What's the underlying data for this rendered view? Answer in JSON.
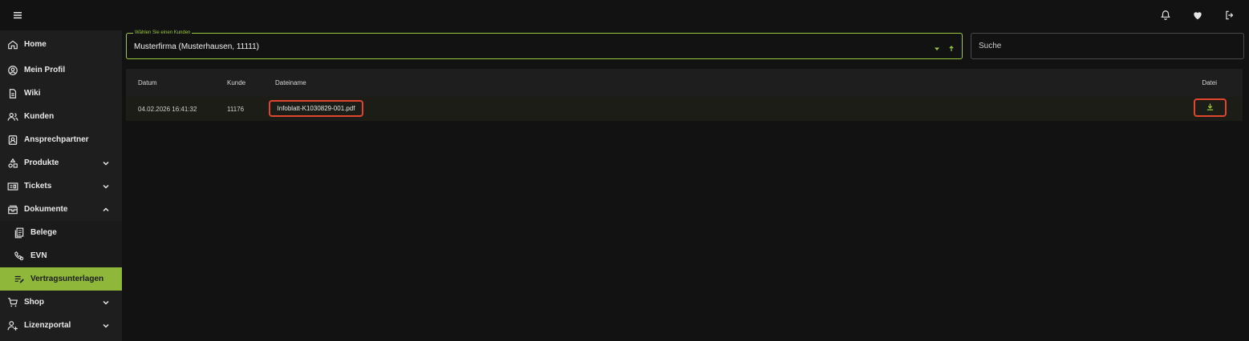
{
  "header": {
    "menu_icon": "hamburger-menu-icon",
    "icons": [
      "bell-icon",
      "heart-icon",
      "logout-icon"
    ]
  },
  "sidebar": {
    "items": [
      {
        "label": "Home",
        "icon": "home-icon"
      },
      {
        "label": "Mein Profil",
        "icon": "profile-icon"
      },
      {
        "label": "Wiki",
        "icon": "document-icon"
      },
      {
        "label": "Kunden",
        "icon": "users-icon"
      },
      {
        "label": "Ansprechpartner",
        "icon": "contact-card-icon"
      },
      {
        "label": "Produkte",
        "icon": "shapes-icon",
        "expandable": true
      },
      {
        "label": "Tickets",
        "icon": "ticket-icon",
        "expandable": true
      },
      {
        "label": "Dokumente",
        "icon": "folder-icon",
        "expandable": true,
        "expanded": true
      },
      {
        "label": "Belege",
        "icon": "receipts-icon",
        "sub": true
      },
      {
        "label": "EVN",
        "icon": "phone-settings-icon",
        "sub": true
      },
      {
        "label": "Vertragsunterlagen",
        "icon": "edit-list-icon",
        "sub": true,
        "active": true
      },
      {
        "label": "Shop",
        "icon": "cart-icon",
        "expandable": true
      },
      {
        "label": "Lizenzportal",
        "icon": "user-add-icon",
        "expandable": true
      }
    ]
  },
  "customer_select": {
    "legend": "Wählen Sie einen Kunden",
    "value": "Musterfirma (Musterhausen,  11111)"
  },
  "search": {
    "placeholder": "Suche"
  },
  "table": {
    "headers": {
      "datum": "Datum",
      "kunde": "Kunde",
      "dateiname": "Dateiname",
      "datei": "Datei"
    },
    "rows": [
      {
        "datum": "04.02.2026 16:41:32",
        "kunde": "11176",
        "dateiname": "Infoblatt-K1030829-001.pdf"
      }
    ]
  },
  "colors": {
    "accent": "#8fb83a",
    "highlight": "#e0452d",
    "background": "#121212"
  }
}
